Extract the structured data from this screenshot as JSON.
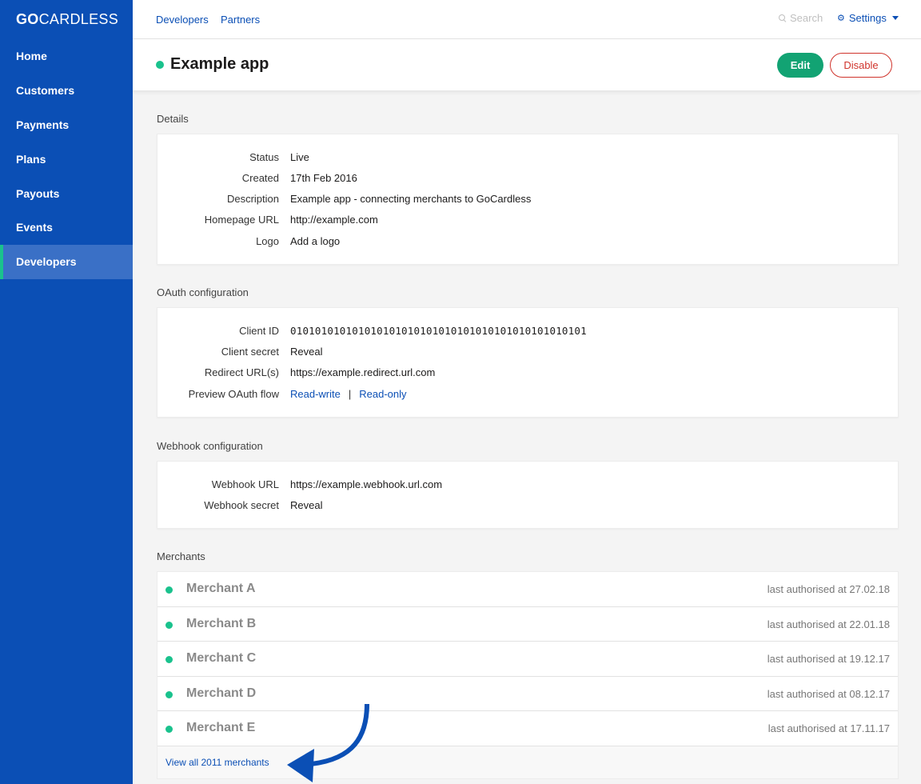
{
  "brand": {
    "logo_bold": "GO",
    "logo_rest": "CARDLESS"
  },
  "sidebar": {
    "items": [
      {
        "label": "Home"
      },
      {
        "label": "Customers"
      },
      {
        "label": "Payments"
      },
      {
        "label": "Plans"
      },
      {
        "label": "Payouts"
      },
      {
        "label": "Events"
      },
      {
        "label": "Developers",
        "active": true
      }
    ]
  },
  "topbar": {
    "links": [
      "Developers",
      "Partners"
    ],
    "search_placeholder": "Search",
    "settings_label": "Settings"
  },
  "header": {
    "title": "Example app",
    "edit_label": "Edit",
    "disable_label": "Disable"
  },
  "details": {
    "title": "Details",
    "status_label": "Status",
    "status_value": "Live",
    "created_label": "Created",
    "created_value": "17th Feb 2016",
    "description_label": "Description",
    "description_value": "Example app - connecting merchants to GoCardless",
    "homepage_label": "Homepage URL",
    "homepage_value": "http://example.com",
    "logo_label": "Logo",
    "logo_value": "Add a logo"
  },
  "oauth": {
    "title": "OAuth configuration",
    "client_id_label": "Client ID",
    "client_id_value": "010101010101010101010101010101010101010101010101",
    "client_secret_label": "Client secret",
    "client_secret_value": "Reveal",
    "redirect_label": "Redirect URL(s)",
    "redirect_value": "https://example.redirect.url.com",
    "preview_label": "Preview OAuth flow",
    "preview_rw": "Read-write",
    "preview_sep": "|",
    "preview_ro": "Read-only"
  },
  "webhook": {
    "title": "Webhook configuration",
    "url_label": "Webhook URL",
    "url_value": "https://example.webhook.url.com",
    "secret_label": "Webhook secret",
    "secret_value": "Reveal"
  },
  "merchants": {
    "title": "Merchants",
    "items": [
      {
        "name": "Merchant A",
        "authorised": "last authorised at 27.02.18"
      },
      {
        "name": "Merchant B",
        "authorised": "last authorised at 22.01.18"
      },
      {
        "name": "Merchant C",
        "authorised": "last authorised at 19.12.17"
      },
      {
        "name": "Merchant D",
        "authorised": "last authorised at 08.12.17"
      },
      {
        "name": "Merchant E",
        "authorised": "last authorised at 17.11.17"
      }
    ],
    "view_all": "View all 2011 merchants"
  },
  "colors": {
    "brand_blue": "#0b4fb5",
    "live_green": "#1ac28d",
    "danger_red": "#d0342c"
  }
}
